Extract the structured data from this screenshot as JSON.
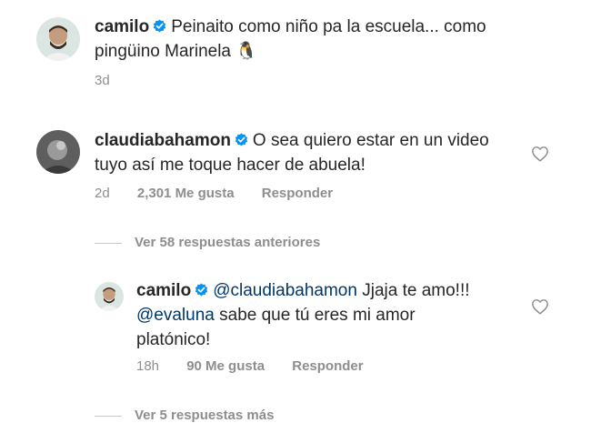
{
  "post_caption": {
    "username": "camilo",
    "text": "Peinaito como niño pa la escuela... como pingüino Marinela",
    "emoji": "🐧",
    "time": "3d"
  },
  "comment": {
    "username": "claudiabahamon",
    "text": "O sea quiero estar en un video tuyo así me toque hacer de abuela!",
    "time": "2d",
    "likes": "2,301 Me gusta",
    "reply_label": "Responder"
  },
  "view_previous_replies": "Ver 58 respuestas anteriores",
  "reply": {
    "username": "camilo",
    "mention_1": "@claudiabahamon",
    "text_1": "Jjaja te amo!!!",
    "mention_2": "@evaluna",
    "text_2": "sabe que tú eres mi amor platónico!",
    "time": "18h",
    "likes": "90 Me gusta",
    "reply_label": "Responder"
  },
  "view_more_replies": "Ver 5 respuestas más",
  "icons": {
    "verified": "verified-badge-icon",
    "like": "heart-outline-icon"
  },
  "colors": {
    "text": "#262626",
    "secondary": "#8e8e8e",
    "verified": "#0095f6",
    "mention": "#00376b"
  }
}
